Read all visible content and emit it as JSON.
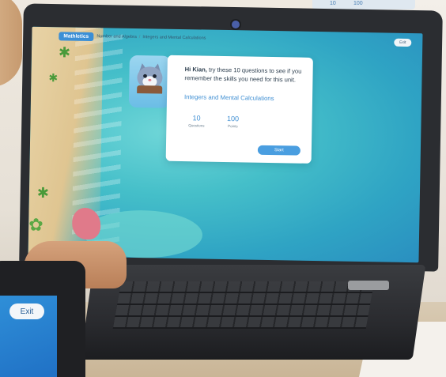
{
  "app": {
    "logo_text": "Mathletics",
    "breadcrumb": [
      "Number and Algebra",
      "Integers and Mental Calculations"
    ],
    "exit_label": "Exit"
  },
  "dialog": {
    "greeting_name": "Hi Kian,",
    "greeting_text": " try these 10 questions to see if you remember the skills you need for this unit.",
    "subject": "Integers and Mental Calculations",
    "stats": [
      {
        "value": "10",
        "label": "Questions"
      },
      {
        "value": "100",
        "label": "Points"
      }
    ],
    "start_label": "Start"
  },
  "tablet": {
    "exit_label": "Exit"
  },
  "background_screen": {
    "values": [
      "10",
      "100"
    ]
  },
  "colors": {
    "accent": "#3f8fd3",
    "button": "#4a9ee0",
    "ocean": "#45bfc9",
    "sand": "#dfc591"
  }
}
